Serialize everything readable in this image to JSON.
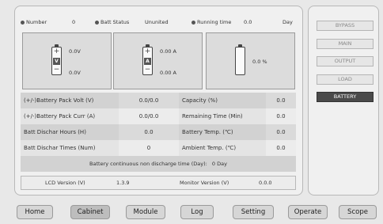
{
  "status": {
    "number_label": "Number",
    "number_value": "0",
    "batt_status_label": "Batt Status",
    "batt_status_value": "Ununited",
    "running_label": "Running time",
    "running_value": "0.0",
    "running_unit": "Day"
  },
  "batteries": {
    "volt": {
      "letter": "V",
      "top_value": "0.0V",
      "bottom_value": "0.0V"
    },
    "curr": {
      "letter": "A",
      "top_value": "0.00 A",
      "bottom_value": "0.00 A"
    },
    "capacity": {
      "value": "0.0 %"
    }
  },
  "rows": [
    {
      "label1": "(+/-)Battery Pack Volt (V)",
      "value1": "0.0/0.0",
      "label2": "Capacity (%)",
      "value2": "0.0"
    },
    {
      "label1": "(+/-)Battery Pack Curr (A)",
      "value1": "0.0/0.0",
      "label2": "Remaining Time (Min)",
      "value2": "0.0"
    },
    {
      "label1": "Batt Dischar Hours (H)",
      "value1": "0.0",
      "label2": "Battery Temp. (℃)",
      "value2": "0.0"
    },
    {
      "label1": "Batt Dischar Times (Num)",
      "value1": "0",
      "label2": "Ambient Temp. (℃)",
      "value2": "0.0"
    }
  ],
  "non_discharge": {
    "label": "Battery continuous non discharge time (Day):",
    "value": "0  Day"
  },
  "versions": {
    "lcd_label": "LCD Version (V)",
    "lcd_value": "1.3.9",
    "monitor_label": "Monitor Version (V)",
    "monitor_value": "0.0.0"
  },
  "side_buttons": [
    "BYPASS",
    "MAIN",
    "OUTPUT",
    "LOAD",
    "BATTERY"
  ],
  "active_side": "BATTERY",
  "tabs": [
    "Home",
    "Cabinet",
    "Module",
    "Log",
    "Setting",
    "Operate",
    "Scope"
  ],
  "active_tab": "Cabinet"
}
